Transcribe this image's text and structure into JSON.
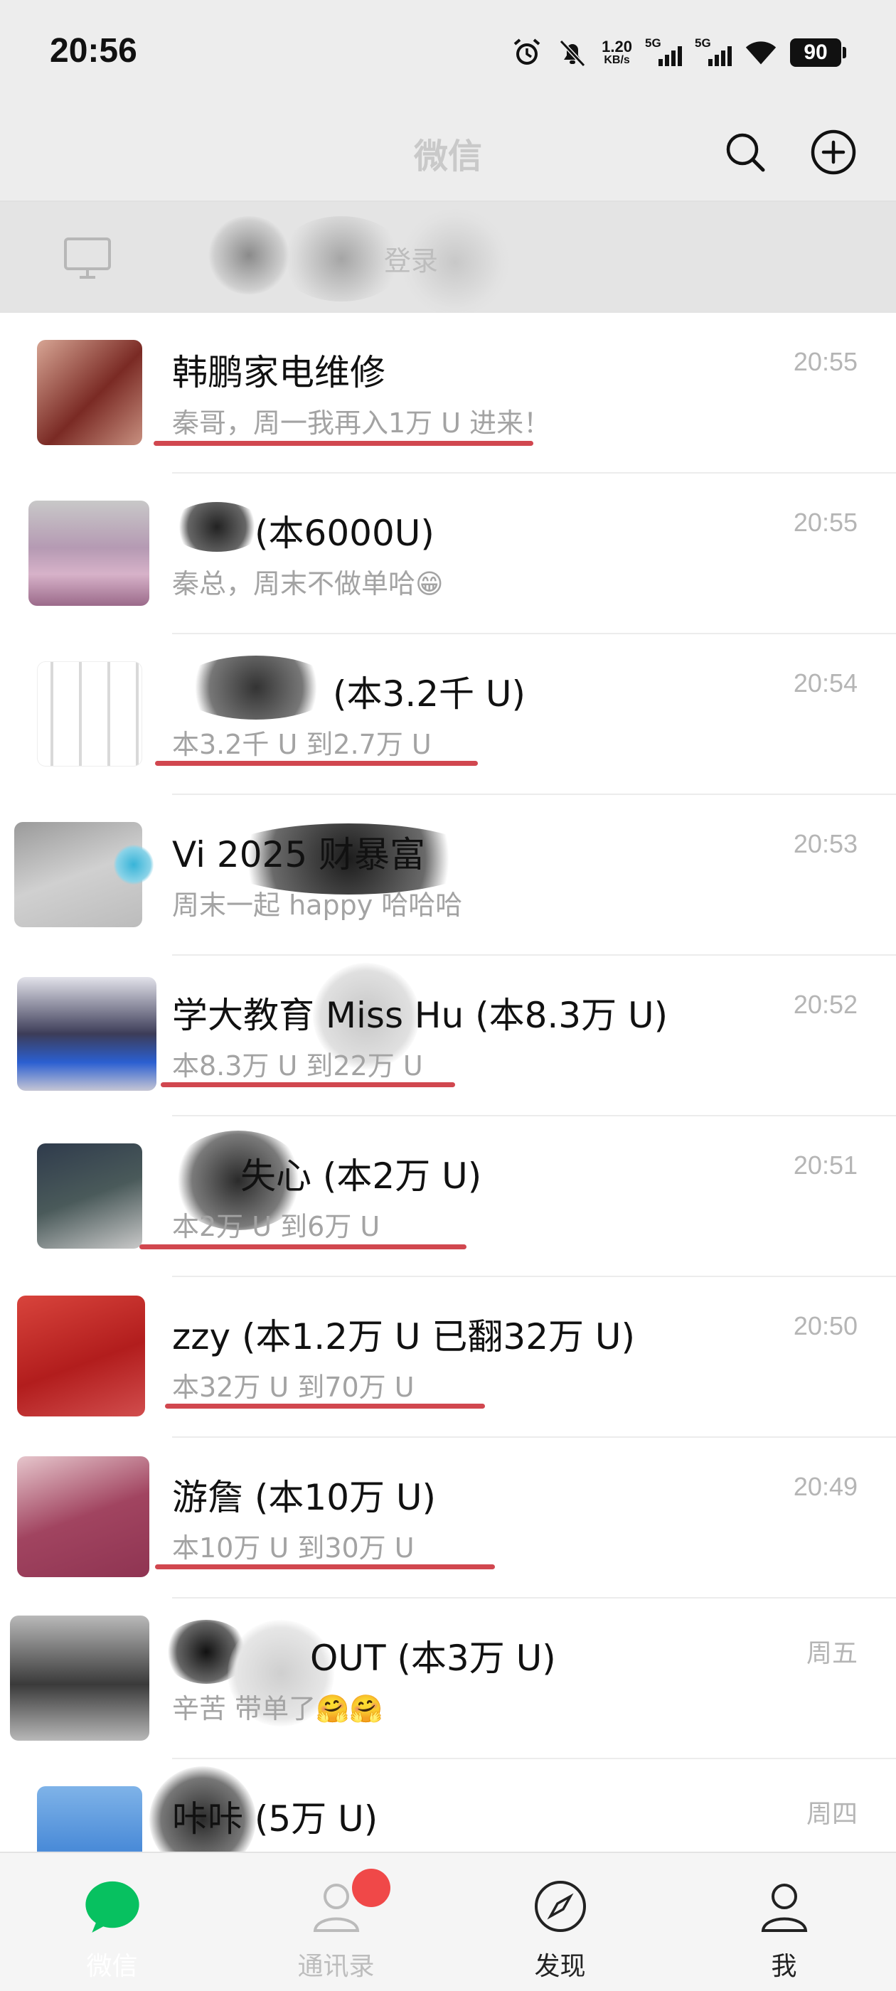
{
  "status_bar": {
    "time": "20:56",
    "net_speed_value": "1.20",
    "net_speed_unit": "KB/s",
    "sim1_label": "5G",
    "sim2_label": "5G",
    "battery": "90",
    "icons": [
      "alarm-icon",
      "mute-bell-icon",
      "wifi-icon"
    ]
  },
  "header": {
    "title": "微信",
    "search_icon": "search-icon",
    "add_icon": "plus-circle-icon"
  },
  "pc_banner": {
    "text": "登录"
  },
  "chats": [
    {
      "name": "韩鹏家电维修",
      "preview": "秦哥，周一我再入1万 U 进来！",
      "time": "20:55"
    },
    {
      "name": "(本6000U)",
      "preview": "秦总，周末不做单哈😁",
      "time": "20:55"
    },
    {
      "name": "(本3.2千 U)",
      "preview": "本3.2千 U 到2.7万 U",
      "time": "20:54"
    },
    {
      "name": "Vi 2025 财暴富",
      "preview": "周末一起 happy 哈哈哈",
      "time": "20:53"
    },
    {
      "name": "学大教育 Miss Hu (本8.3万 U)",
      "preview": "本8.3万 U 到22万 U",
      "time": "20:52"
    },
    {
      "name": "失心 (本2万 U)",
      "preview": "本2万 U 到6万 U",
      "time": "20:51"
    },
    {
      "name": "zzy (本1.2万 U 已翻32万 U)",
      "preview": "本32万 U 到70万 U",
      "time": "20:50"
    },
    {
      "name": "游詹 (本10万 U)",
      "preview": "本10万 U 到30万 U",
      "time": "20:49"
    },
    {
      "name": "OUT (本3万 U)",
      "preview": "辛苦 带单了🤗🤗",
      "time": "周五"
    },
    {
      "name": "咔咔 (5万 U)",
      "preview": "",
      "time": "周四"
    }
  ],
  "tab_bar": {
    "tabs": [
      {
        "label": "微信",
        "icon": "chat-bubble-icon",
        "active": true
      },
      {
        "label": "通讯录",
        "icon": "contacts-icon",
        "active": false
      },
      {
        "label": "发现",
        "icon": "compass-icon",
        "active": false
      },
      {
        "label": "我",
        "icon": "person-icon",
        "active": false
      }
    ]
  },
  "colors": {
    "accent_green": "#07c160",
    "badge_red": "#f04848",
    "underline_red": "#d1474f",
    "background": "#ededed"
  }
}
